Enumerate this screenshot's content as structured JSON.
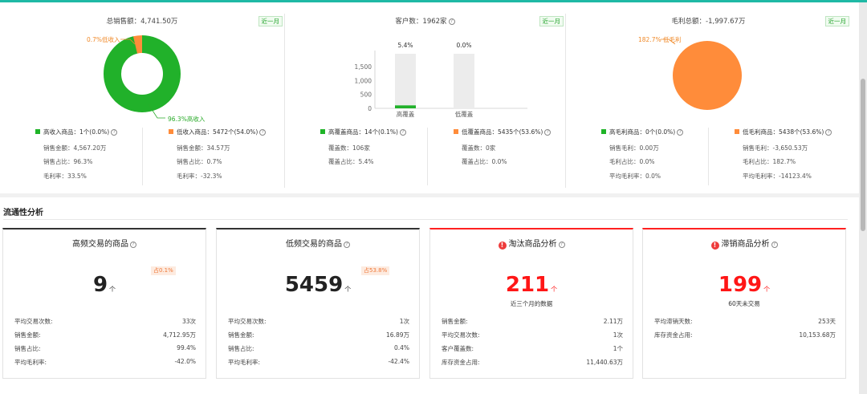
{
  "overview": {
    "sales": {
      "title": "总销售额：4,741.50万",
      "badge": "近一月",
      "pie": {
        "low_label": "0.7%低收入",
        "high_label": "96.3%高收入",
        "high_share": 0.963,
        "low_share": 0.037,
        "colors": {
          "high": "#21b12a",
          "low": "#ff8c3a"
        }
      },
      "left": {
        "head": "高收入商品：1个(0.0%)",
        "rows": [
          "销售金额：4,567.20万",
          "销售占比：96.3%",
          "毛利率：33.5%"
        ]
      },
      "right": {
        "head": "低收入商品：5472个(54.0%)",
        "rows": [
          "销售金额：34.57万",
          "销售占比：0.7%",
          "毛利率：-32.3%"
        ]
      }
    },
    "customers": {
      "title": "客户数：1962家",
      "badge": "近一月",
      "chart_data": {
        "type": "bar",
        "categories": [
          "高覆盖",
          "低覆盖"
        ],
        "values": [
          106,
          0
        ],
        "value_labels": [
          "5.4%",
          "0.0%"
        ],
        "track_max": 1962,
        "yticks": [
          "0",
          "500",
          "1,000",
          "1,500"
        ],
        "ylim": [
          0,
          1962
        ],
        "colors": {
          "bar": "#21b12a",
          "track": "#ececec"
        }
      },
      "left": {
        "head": "高覆盖商品：14个(0.1%)",
        "rows": [
          "覆盖数：106家",
          "覆盖占比：5.4%"
        ]
      },
      "right": {
        "head": "低覆盖商品：5435个(53.6%)",
        "rows": [
          "覆盖数：0家",
          "覆盖占比：0.0%"
        ]
      }
    },
    "profit": {
      "title": "毛利总额：-1,997.67万",
      "badge": "近一月",
      "pie": {
        "low_label": "182.7% 低毛利",
        "low_share": 1.0,
        "colors": {
          "low": "#ff8c3a"
        }
      },
      "left": {
        "head": "高毛利商品：0个(0.0%)",
        "rows": [
          "销售毛利：0.00万",
          "毛利占比：0.0%",
          "平均毛利率：0.0%"
        ]
      },
      "right": {
        "head": "低毛利商品：5438个(53.6%)",
        "rows": [
          "销售毛利：-3,650.53万",
          "毛利占比：182.7%",
          "平均毛利率：-14123.4%"
        ]
      }
    }
  },
  "liquidity": {
    "title": "流通性分析",
    "cards": [
      {
        "title": "高频交易的商品",
        "percent": "占0.1%",
        "value": "9",
        "unit": "个",
        "subtitle": "",
        "rows": [
          {
            "k": "平均交易次数:",
            "v": "33次"
          },
          {
            "k": "销售金额:",
            "v": "4,712.95万"
          },
          {
            "k": "销售占比:",
            "v": "99.4%"
          },
          {
            "k": "平均毛利率:",
            "v": "-42.0%"
          }
        ]
      },
      {
        "title": "低频交易的商品",
        "percent": "占53.8%",
        "value": "5459",
        "unit": "个",
        "subtitle": "",
        "rows": [
          {
            "k": "平均交易次数:",
            "v": "1次"
          },
          {
            "k": "销售金额:",
            "v": "16.89万"
          },
          {
            "k": "销售占比:",
            "v": "0.4%"
          },
          {
            "k": "平均毛利率:",
            "v": "-42.4%"
          }
        ]
      },
      {
        "title": "淘汰商品分析",
        "percent": "",
        "value": "211",
        "unit": "个",
        "subtitle": "近三个月的数据",
        "rows": [
          {
            "k": "销售金额:",
            "v": "2.11万"
          },
          {
            "k": "平均交易次数:",
            "v": "1次"
          },
          {
            "k": "客户覆盖数:",
            "v": "1个"
          },
          {
            "k": "库存资金占用:",
            "v": "11,440.63万"
          }
        ]
      },
      {
        "title": "滞销商品分析",
        "percent": "",
        "value": "199",
        "unit": "个",
        "subtitle": "60天未交易",
        "rows": [
          {
            "k": "平均滞销天数:",
            "v": "253天"
          },
          {
            "k": "库存资金占用:",
            "v": "10,153.68万"
          }
        ]
      }
    ]
  }
}
